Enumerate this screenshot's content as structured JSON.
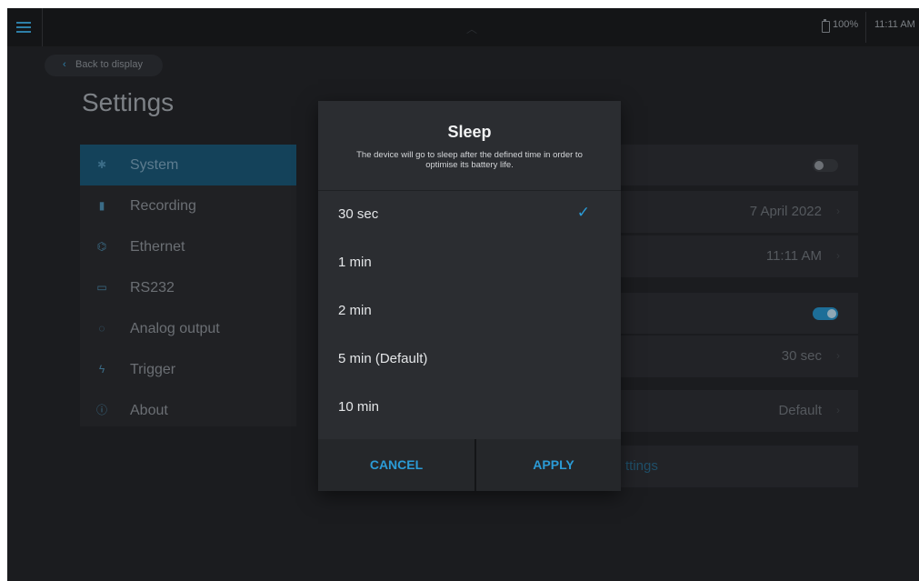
{
  "status_bar": {
    "battery": "100%",
    "time": "11:11 AM"
  },
  "back_button": {
    "label": "Back to display"
  },
  "page_title": "Settings",
  "sidebar": {
    "items": [
      {
        "label": "System",
        "icon": "gear-icon",
        "active": true
      },
      {
        "label": "Recording",
        "icon": "file-icon"
      },
      {
        "label": "Ethernet",
        "icon": "ethernet-icon"
      },
      {
        "label": "RS232",
        "icon": "serial-port-icon"
      },
      {
        "label": "Analog output",
        "icon": "gauge-icon"
      },
      {
        "label": "Trigger",
        "icon": "lightning-icon"
      },
      {
        "label": "About",
        "icon": "info-icon"
      }
    ]
  },
  "settings_rows": {
    "date": "7 April 2022",
    "time": "11:11 AM",
    "sleep": "30 sec",
    "default": "Default",
    "link_fragment": "ttings"
  },
  "dialog": {
    "title": "Sleep",
    "description": "The device will go to sleep after the defined time in order to optimise its battery life.",
    "options": [
      {
        "label": "30 sec",
        "selected": true
      },
      {
        "label": "1 min"
      },
      {
        "label": "2 min"
      },
      {
        "label": "5 min (Default)"
      },
      {
        "label": "10 min"
      }
    ],
    "cancel_label": "CANCEL",
    "apply_label": "APPLY"
  },
  "colors": {
    "accent": "#2b9bd6",
    "active_bg": "#14425a",
    "dialog_bg": "#2b2d31"
  }
}
